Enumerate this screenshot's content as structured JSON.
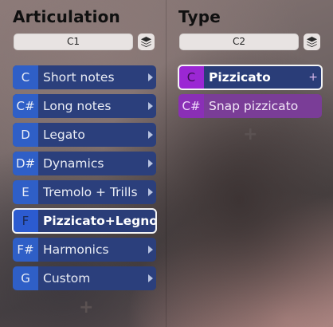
{
  "articulation": {
    "title": "Articulation",
    "key_value": "C1",
    "add_symbol": "+",
    "items": [
      {
        "note": "C",
        "label": "Short notes"
      },
      {
        "note": "C#",
        "label": "Long notes"
      },
      {
        "note": "D",
        "label": "Legato"
      },
      {
        "note": "D#",
        "label": "Dynamics"
      },
      {
        "note": "E",
        "label": "Tremolo + Trills"
      },
      {
        "note": "F",
        "label": "Pizzicato+Legno",
        "selected": true
      },
      {
        "note": "F#",
        "label": "Harmonics"
      },
      {
        "note": "G",
        "label": "Custom"
      }
    ]
  },
  "type": {
    "title": "Type",
    "key_value": "C2",
    "add_symbol": "+",
    "items": [
      {
        "note": "C",
        "label": "Pizzicato",
        "selected": true
      },
      {
        "note": "C#",
        "label": "Snap pizzicato"
      }
    ]
  },
  "colors": {
    "articulation_slot": "#2b3f7c",
    "articulation_note": "#2f5fc7",
    "type_slot": "#8c3cb0",
    "type_note": "#9b27d4",
    "selection_outline": "#f4f4f4"
  },
  "icons": {
    "layers": "layers-icon",
    "arrow": "chevron-right-icon",
    "add": "plus-icon"
  }
}
